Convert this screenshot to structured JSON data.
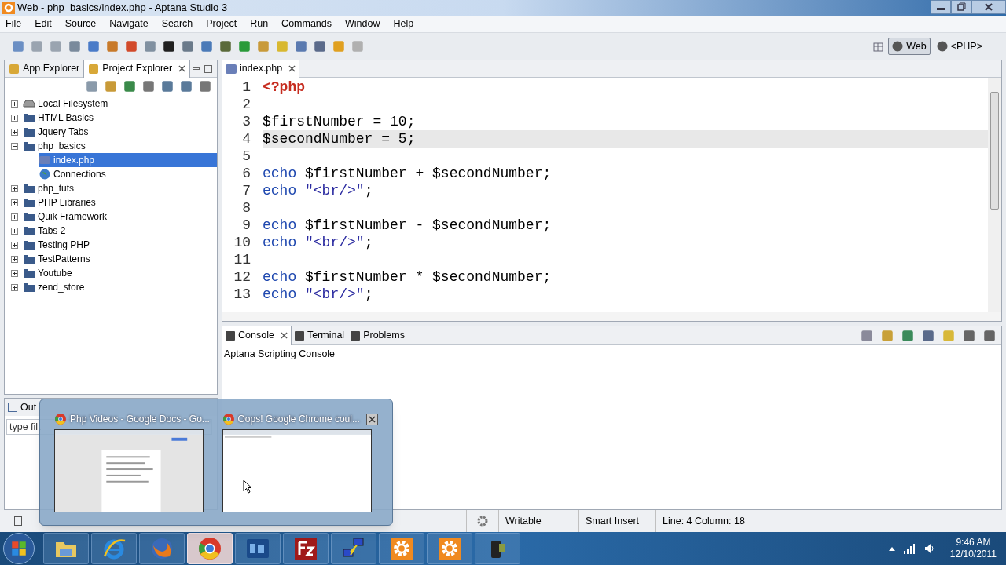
{
  "window": {
    "title": "Web - php_basics/index.php - Aptana Studio 3"
  },
  "menu": [
    "File",
    "Edit",
    "Source",
    "Navigate",
    "Search",
    "Project",
    "Run",
    "Commands",
    "Window",
    "Help"
  ],
  "perspectives": [
    {
      "label": "Web",
      "selected": true
    },
    {
      "label": "<PHP>",
      "selected": false
    }
  ],
  "left_tabs": [
    {
      "label": "App Explorer",
      "selected": false,
      "closable": false
    },
    {
      "label": "Project Explorer",
      "selected": true,
      "closable": true
    }
  ],
  "tree": [
    {
      "label": "Local Filesystem",
      "kind": "drive",
      "expanded": false,
      "selected": false
    },
    {
      "label": "HTML Basics",
      "kind": "project",
      "expanded": false,
      "selected": false
    },
    {
      "label": "Jquery Tabs",
      "kind": "project",
      "expanded": false,
      "selected": false
    },
    {
      "label": "php_basics",
      "kind": "project",
      "expanded": true,
      "selected": false,
      "children": [
        {
          "label": "index.php",
          "kind": "php",
          "selected": true
        },
        {
          "label": "Connections",
          "kind": "globe",
          "selected": false
        }
      ]
    },
    {
      "label": "php_tuts",
      "kind": "project",
      "expanded": false,
      "selected": false
    },
    {
      "label": "PHP Libraries",
      "kind": "project",
      "expanded": false,
      "selected": false
    },
    {
      "label": "Quik Framework",
      "kind": "project",
      "expanded": false,
      "selected": false
    },
    {
      "label": "Tabs 2",
      "kind": "project",
      "expanded": false,
      "selected": false
    },
    {
      "label": "Testing PHP",
      "kind": "project",
      "expanded": false,
      "selected": false
    },
    {
      "label": "TestPatterns",
      "kind": "project",
      "expanded": false,
      "selected": false
    },
    {
      "label": "Youtube",
      "kind": "project",
      "expanded": false,
      "selected": false
    },
    {
      "label": "zend_store",
      "kind": "project",
      "expanded": false,
      "selected": false
    }
  ],
  "outline": {
    "tab": "Out",
    "filter_placeholder": "type filt"
  },
  "editor": {
    "tab": "index.php",
    "lines": [
      {
        "number": "1",
        "selected": false,
        "tokens": [
          {
            "text": "<?php",
            "kind": "tag"
          }
        ]
      },
      {
        "number": "2",
        "selected": false
      },
      {
        "number": "3",
        "selected": false,
        "tokens": [
          {
            "text": "$firstNumber = 10;",
            "kind": "plain"
          }
        ]
      },
      {
        "number": "4",
        "selected": true,
        "tokens": [
          {
            "text": "$secondNumber = 5;",
            "kind": "plain"
          }
        ]
      },
      {
        "number": "5",
        "selected": false
      },
      {
        "number": "6",
        "selected": false,
        "tokens": [
          {
            "text": "echo",
            "kind": "keyword"
          },
          {
            "text": "$firstNumber + $secondNumber;",
            "kind": "plain"
          }
        ]
      },
      {
        "number": "7",
        "selected": false,
        "tokens": [
          {
            "text": "echo",
            "kind": "keyword"
          },
          {
            "text": "\"<br/>\"",
            "kind": "string"
          },
          {
            "text": ";",
            "kind": "plain"
          }
        ]
      },
      {
        "number": "8",
        "selected": false
      },
      {
        "number": "9",
        "selected": false,
        "tokens": [
          {
            "text": "echo",
            "kind": "keyword"
          },
          {
            "text": "$firstNumber - $secondNumber;",
            "kind": "plain"
          }
        ]
      },
      {
        "number": "10",
        "selected": false,
        "tokens": [
          {
            "text": "echo",
            "kind": "keyword"
          },
          {
            "text": "\"<br/>\"",
            "kind": "string"
          },
          {
            "text": ";",
            "kind": "plain"
          }
        ]
      },
      {
        "number": "11",
        "selected": false
      },
      {
        "number": "12",
        "selected": false,
        "tokens": [
          {
            "text": "echo",
            "kind": "keyword"
          },
          {
            "text": "$firstNumber * $secondNumber;",
            "kind": "plain"
          }
        ]
      },
      {
        "number": "13",
        "selected": false,
        "tokens": [
          {
            "text": "echo",
            "kind": "keyword"
          },
          {
            "text": "\"<br/>\"",
            "kind": "string"
          },
          {
            "text": ";",
            "kind": "plain"
          }
        ]
      }
    ]
  },
  "console": {
    "tabs": [
      {
        "label": "Console",
        "selected": true
      },
      {
        "label": "Terminal",
        "selected": false
      },
      {
        "label": "Problems",
        "selected": false
      }
    ],
    "title": "Aptana Scripting Console"
  },
  "status_bar": [
    "Writable",
    "Smart Insert",
    "Line: 4 Column: 18"
  ],
  "thumbnails": [
    {
      "title": "Php Videos - Google Docs - Go...",
      "kind": "picture",
      "closable": false
    },
    {
      "title": "Oops! Google Chrome coul...",
      "kind": "picture",
      "closable": true
    }
  ],
  "taskbar": [
    {
      "kind": "folder",
      "selected": false
    },
    {
      "kind": "ie",
      "selected": false
    },
    {
      "kind": "firefox",
      "selected": false
    },
    {
      "kind": "chrome",
      "selected": true
    },
    {
      "kind": "ps",
      "selected": false
    },
    {
      "kind": "fz",
      "selected": false
    },
    {
      "kind": "network",
      "selected": false
    },
    {
      "kind": "gear",
      "selected": false
    },
    {
      "kind": "gear",
      "selected": false
    },
    {
      "kind": "camera",
      "selected": false
    }
  ],
  "clock": {
    "time": "9:46 AM",
    "date": "12/10/2011"
  }
}
